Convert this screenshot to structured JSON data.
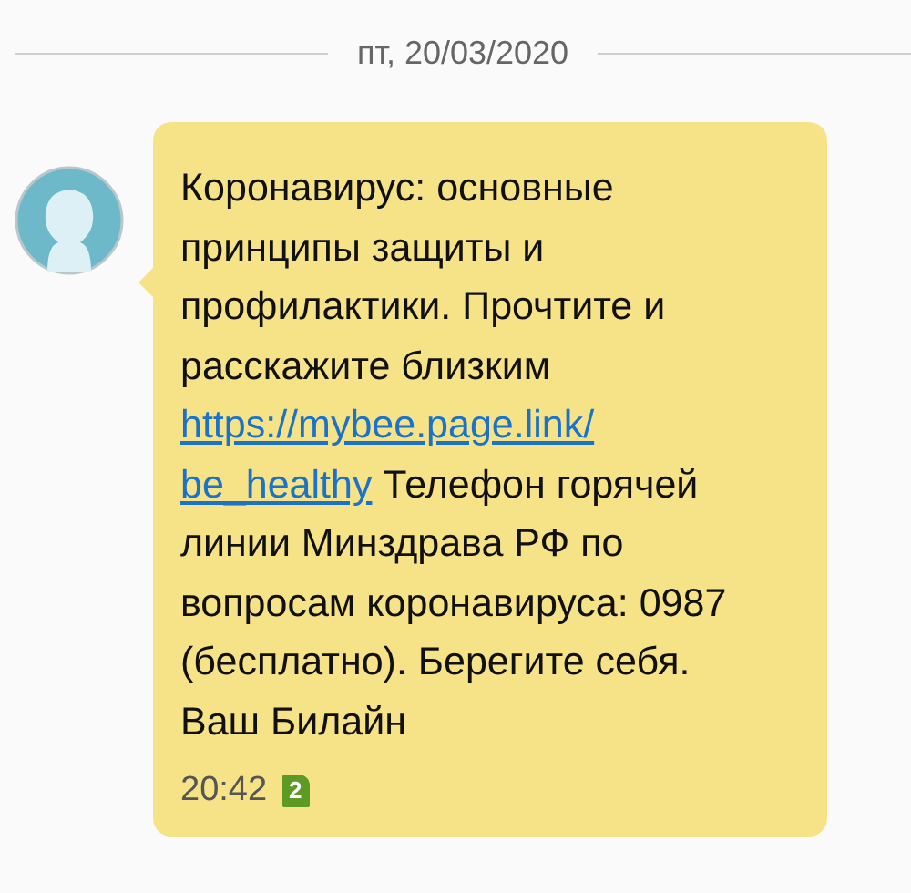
{
  "date_separator": "пт, 20/03/2020",
  "message": {
    "text_before": "Коронавирус: основные принципы защиты и профилактики. Прочтите и расскажите близким",
    "link_lines": [
      "https://mybee.page.link/",
      "be_healthy"
    ],
    "text_after": "Телефон горячей линии Минздрава РФ по вопросам коронавируса: 0987 (бесплатно). Берегите себя. Ваш Билайн",
    "time": "20:42",
    "sim": "2"
  }
}
